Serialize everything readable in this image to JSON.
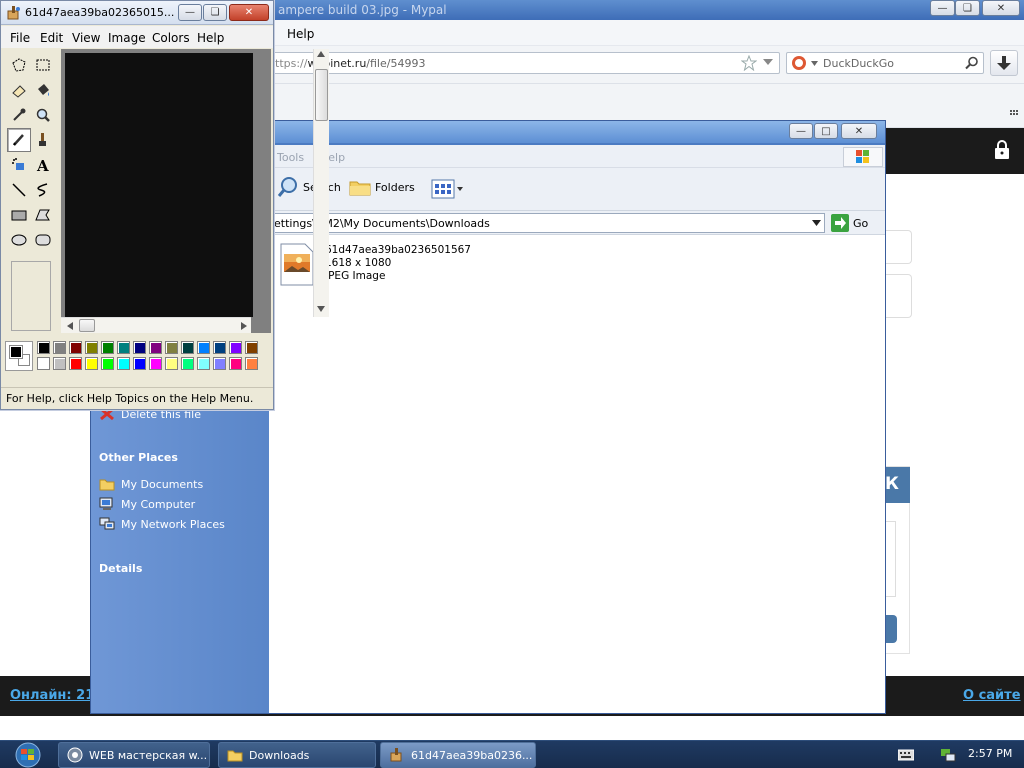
{
  "browser": {
    "title": "ampere build 03.jpg - Mypal",
    "menu_help": "Help",
    "url_prefix": "ttps://",
    "url_host": "wapinet.ru",
    "url_path": "/file/54993",
    "search_placeholder": "DuckDuckGo",
    "footer_left": "Онлайн: 21",
    "footer_right": "О сайте",
    "partial_text": "К"
  },
  "explorer": {
    "menu": [
      "Tools",
      "Help"
    ],
    "toolbar": {
      "search": "Search",
      "folders": "Folders"
    },
    "address": "ettings\\VM2\\My Documents\\Downloads",
    "go_label": "Go",
    "file": {
      "name": "61d47aea39ba0236501567",
      "dimensions": "1618 x 1080",
      "type": "JPEG Image"
    },
    "left_panel": {
      "delete_link": "Delete this file",
      "other_places_title": "Other Places",
      "places": [
        "My Documents",
        "My Computer",
        "My Network Places"
      ],
      "details_title": "Details"
    }
  },
  "paint": {
    "title": "61d47aea39ba02365015...",
    "menu": [
      "File",
      "Edit",
      "View",
      "Image",
      "Colors",
      "Help"
    ],
    "status": "For Help, click Help Topics on the Help Menu.",
    "palette_top": [
      "#000000",
      "#808080",
      "#800000",
      "#808000",
      "#008000",
      "#008080",
      "#000080",
      "#800080",
      "#808040",
      "#004040",
      "#0080ff",
      "#004080",
      "#8000ff",
      "#804000"
    ],
    "palette_bottom": [
      "#ffffff",
      "#c0c0c0",
      "#ff0000",
      "#ffff00",
      "#00ff00",
      "#00ffff",
      "#0000ff",
      "#ff00ff",
      "#ffff80",
      "#00ff80",
      "#80ffff",
      "#8080ff",
      "#ff0080",
      "#ff8040"
    ]
  },
  "taskbar": {
    "tasks": [
      "WEB мастерская w...",
      "Downloads",
      "61d47aea39ba0236..."
    ],
    "clock": "2:57 PM"
  }
}
